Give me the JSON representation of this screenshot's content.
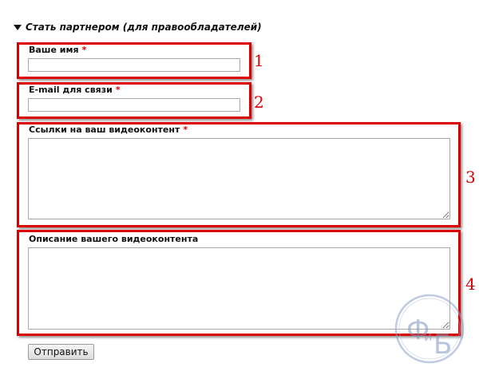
{
  "fieldset": {
    "legend": "Стать партнером (для правообладателей)"
  },
  "fields": {
    "name": {
      "label": "Ваше имя",
      "required_mark": "*",
      "value": ""
    },
    "email": {
      "label": "E-mail для связи",
      "required_mark": "*",
      "value": ""
    },
    "links": {
      "label": "Ссылки на ваш видеоконтент",
      "required_mark": "*",
      "value": ""
    },
    "description": {
      "label": "Описание вашего видеоконтента",
      "value": ""
    }
  },
  "annotations": {
    "n1": "1",
    "n2": "2",
    "n3": "3",
    "n4": "4",
    "color": "#dd0000"
  },
  "submit_label": "Отправить",
  "watermark": {
    "letter_left": "Ф",
    "letter_right": "Б",
    "letter_small": "и"
  }
}
